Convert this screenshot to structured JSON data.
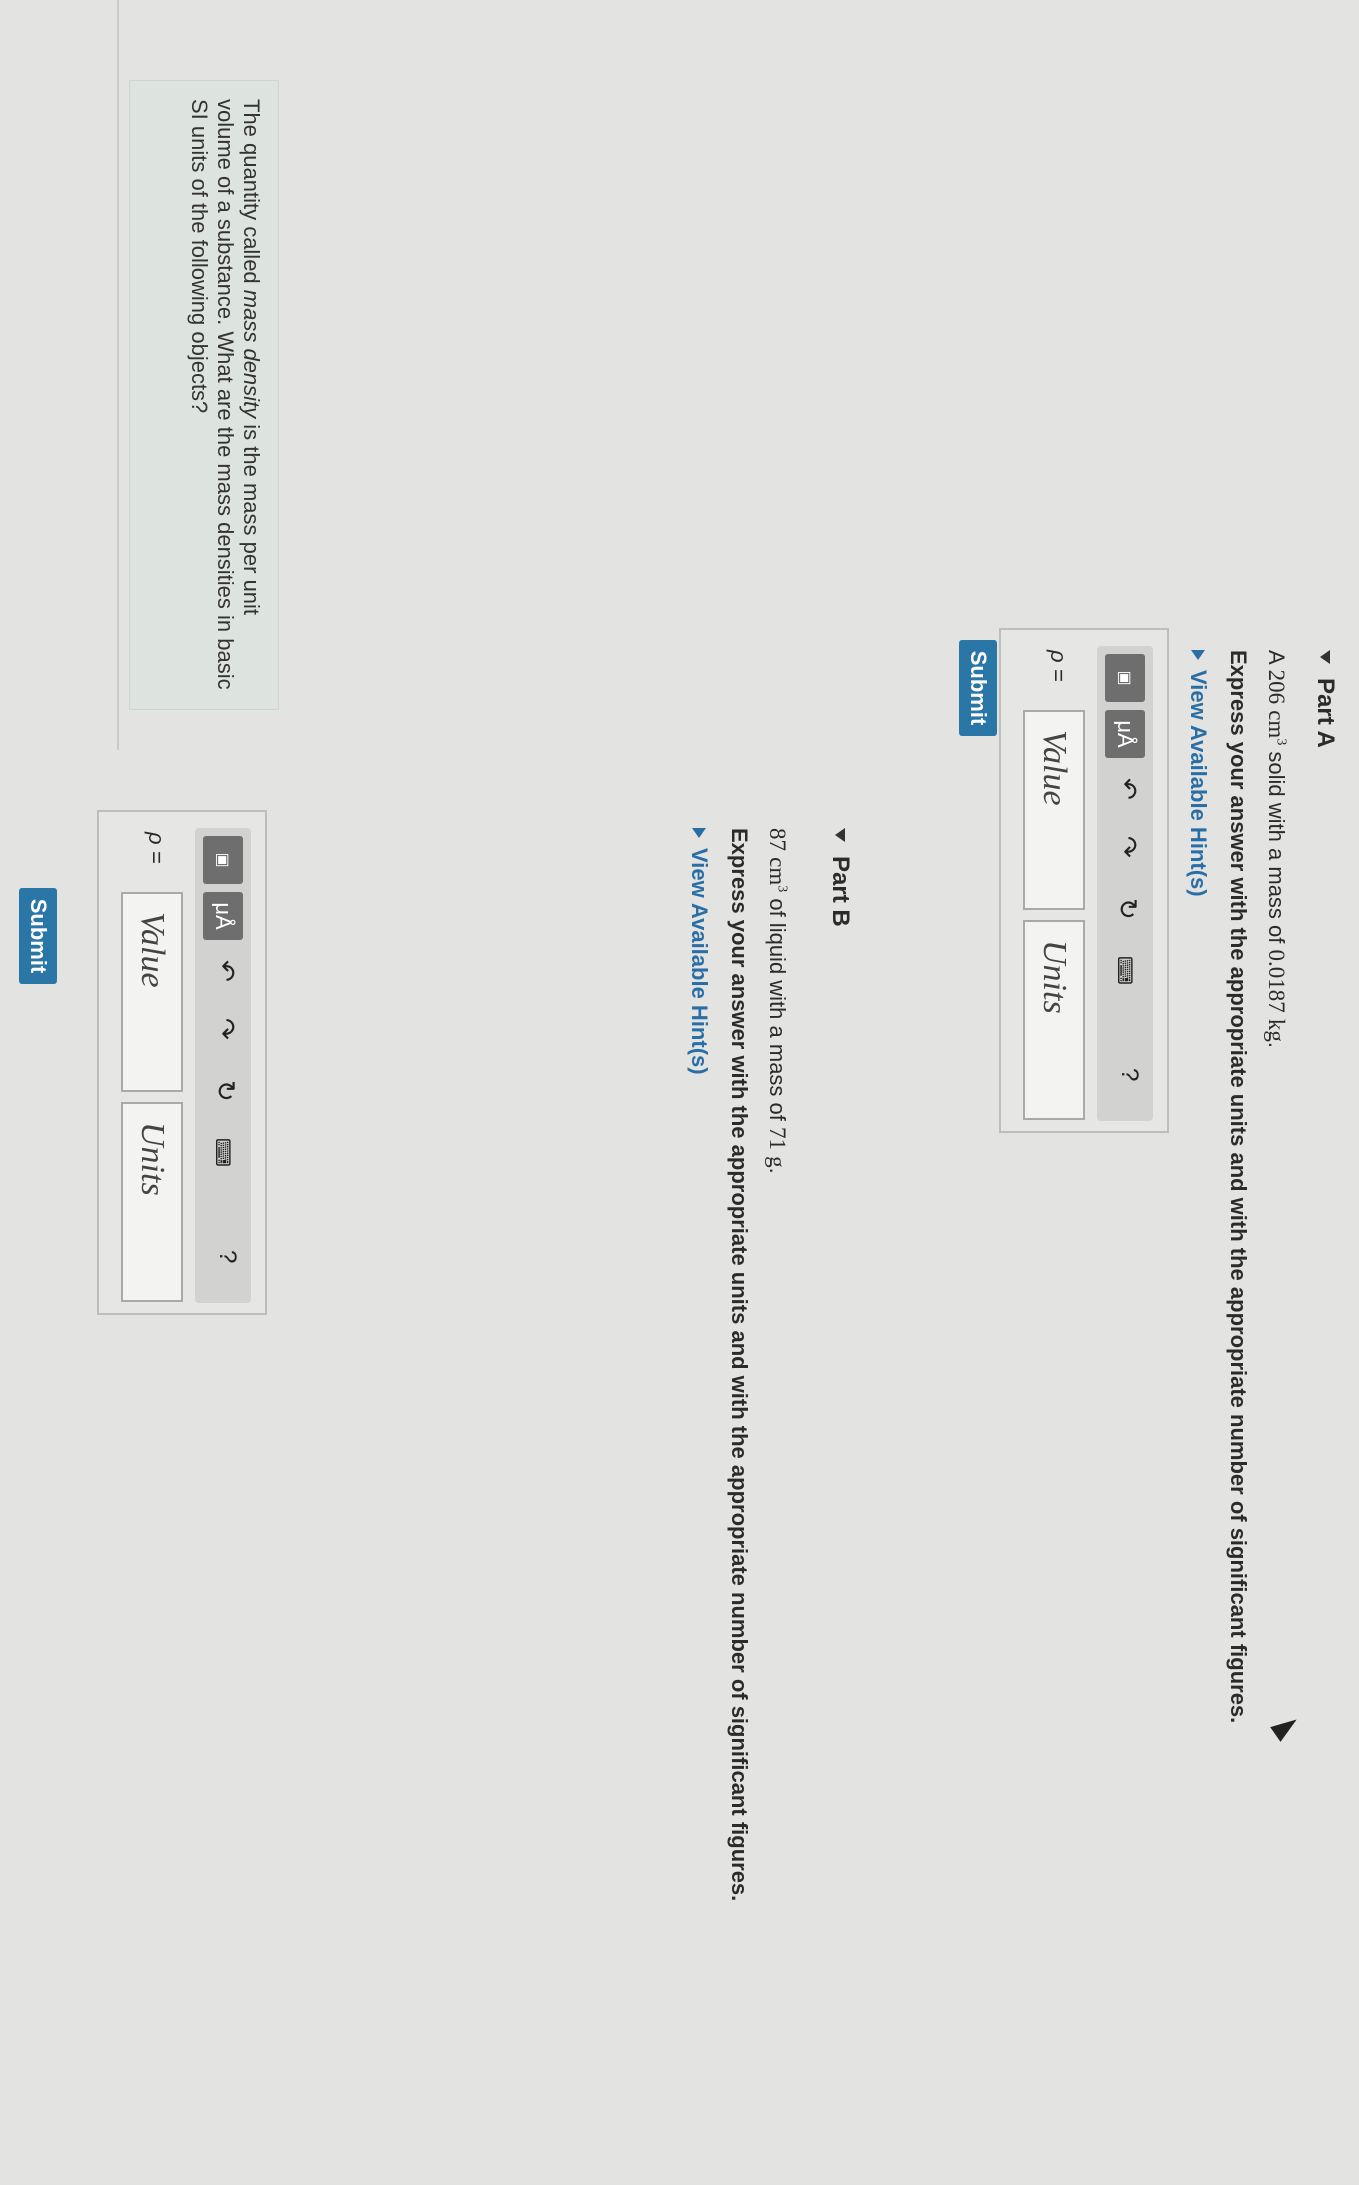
{
  "intro": {
    "text_before": "The quantity called ",
    "text_em": "mass density",
    "text_after": " is the mass per unit volume of a substance. What are the mass densities in basic SI units of the following objects?"
  },
  "part_a": {
    "header": "Part A",
    "statement_prefix": "A ",
    "volume_value": "206",
    "volume_unit": "cm",
    "volume_exp": "3",
    "statement_mid": " solid with a mass of ",
    "mass_value": "0.0187",
    "mass_unit": "kg",
    "statement_end": ".",
    "instruction": "Express your answer with the appropriate units and with the appropriate number of significant figures.",
    "hints_label": "View Available Hint(s)",
    "rho_label": "ρ =",
    "value_placeholder": "Value",
    "units_placeholder": "Units",
    "submit_label": "Submit"
  },
  "part_b": {
    "header": "Part B",
    "volume_value": "87",
    "volume_unit": "cm",
    "volume_exp": "3",
    "statement_mid": " of liquid with a mass of ",
    "mass_value": "71",
    "mass_unit": "g",
    "statement_end": ".",
    "instruction": "Express your answer with the appropriate units and with the appropriate number of significant figures.",
    "hints_label": "View Available Hint(s)",
    "rho_label": "ρ =",
    "value_placeholder": "Value",
    "units_placeholder": "Units",
    "submit_label": "Submit"
  },
  "toolbar": {
    "units_symbol": "μÅ",
    "undo_glyph": "↶",
    "redo_glyph": "↷",
    "reset_glyph": "↻",
    "keyboard_glyph": "⌨",
    "help_glyph": "?",
    "icons": [
      "templates-icon",
      "units-icon",
      "undo-icon",
      "redo-icon",
      "reset-icon",
      "keyboard-icon",
      "help-icon"
    ]
  },
  "colors": {
    "accent": "#2a76a6",
    "hint_link": "#2a6ea6",
    "intro_bg": "#dde3de"
  }
}
